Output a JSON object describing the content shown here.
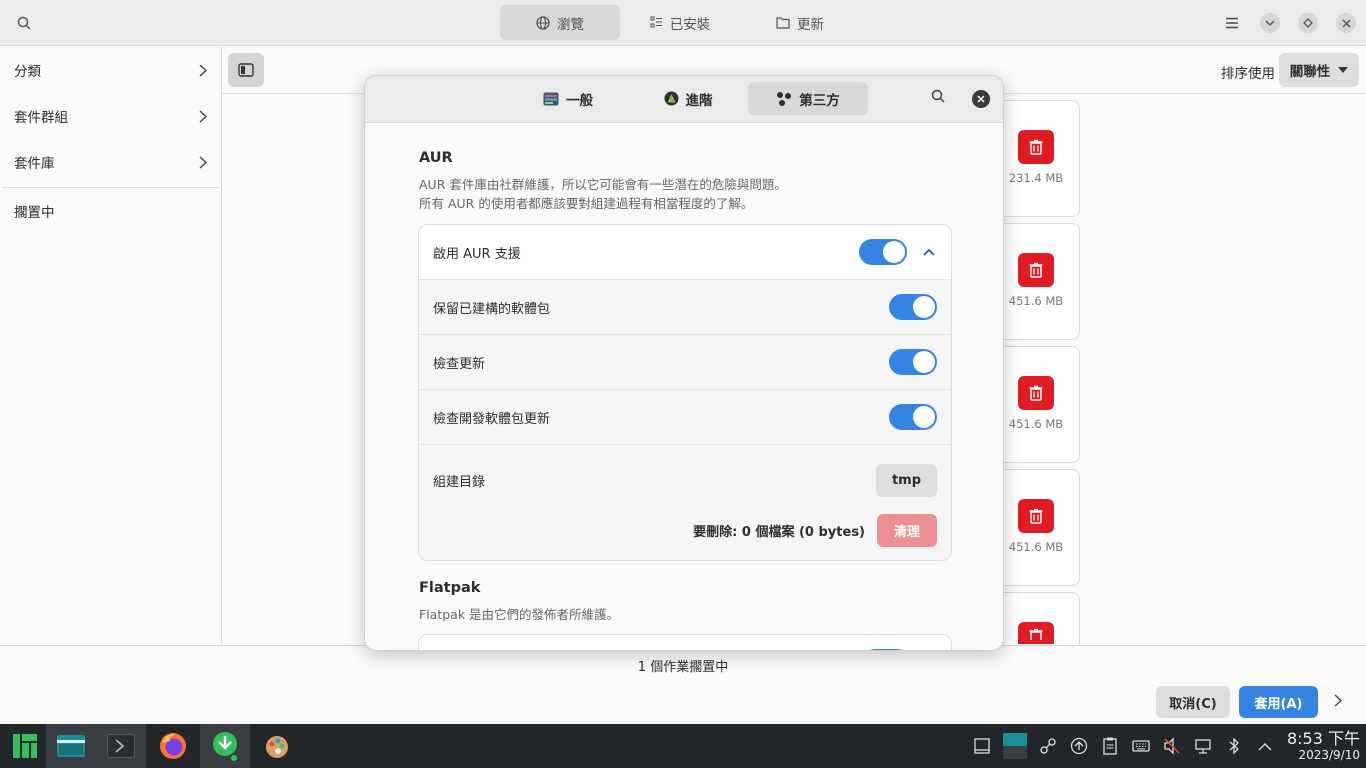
{
  "header": {
    "tabs": [
      {
        "label": "瀏覽",
        "icon": "globe-icon"
      },
      {
        "label": "已安裝",
        "icon": "list-icon"
      },
      {
        "label": "更新",
        "icon": "folder-icon"
      }
    ]
  },
  "sidebar": {
    "items": [
      {
        "label": "分類"
      },
      {
        "label": "套件群組"
      },
      {
        "label": "套件庫"
      }
    ],
    "pending_label": "擱置中"
  },
  "content": {
    "sort_label": "排序使用",
    "sort_value": "關聯性",
    "package_sizes": [
      "231.4 MB",
      "451.6 MB",
      "451.6 MB",
      "451.6 MB"
    ]
  },
  "dialog": {
    "tabs": [
      {
        "label": "一般",
        "icon": "general-settings-icon"
      },
      {
        "label": "進階",
        "icon": "advanced-icon"
      },
      {
        "label": "第三方",
        "icon": "third-party-icon"
      }
    ],
    "aur": {
      "title": "AUR",
      "desc_line1": "AUR 套件庫由社群維護，所以它可能會有一些潛在的危險與問題。",
      "desc_line2": "所有 AUR 的使用者都應該要對組建過程有相當程度的了解。",
      "enable_label": "啟用 AUR 支援",
      "keep_built_label": "保留已建構的軟體包",
      "check_updates_label": "檢查更新",
      "check_dev_updates_label": "檢查開發軟體包更新",
      "build_dir_label": "組建目錄",
      "build_dir_value": "tmp",
      "to_delete": "要刪除:  0 個檔案  (0 bytes)",
      "clean_label": "清理"
    },
    "flatpak": {
      "title": "Flatpak",
      "desc": "Flatpak 是由它們的發佈者所維護。"
    }
  },
  "bottom": {
    "pending_text": "1 個作業擱置中",
    "cancel_label": "取消(C)",
    "apply_label": "套用(A)"
  },
  "taskbar": {
    "time": "8:53 下午",
    "date": "2023/9/10"
  },
  "colors": {
    "accent": "#3584e4",
    "danger": "#e01b24",
    "taskbar": "#232629"
  }
}
